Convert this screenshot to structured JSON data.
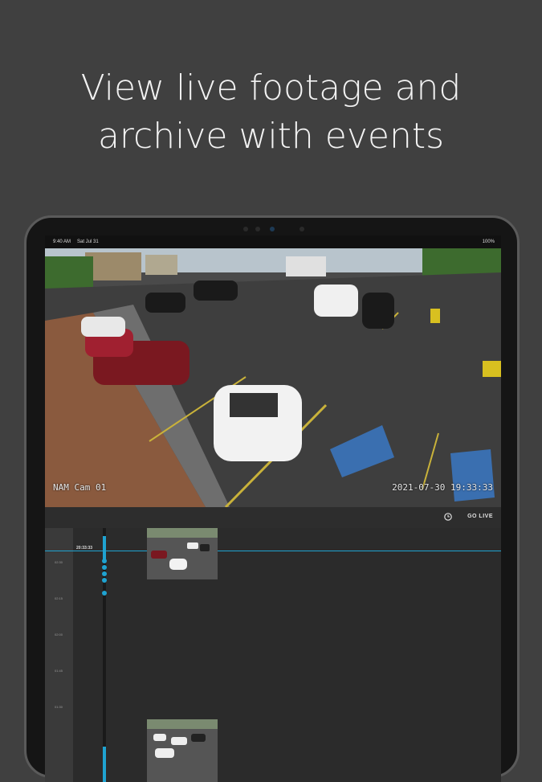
{
  "headline": {
    "line1": "View live footage and",
    "line2": "archive with events"
  },
  "status_bar": {
    "time": "9:40 AM",
    "date": "Sat Jul 31",
    "battery": "100%"
  },
  "camera": {
    "name": "NAM Cam 01",
    "timestamp": "2021-07-30 19:33:33"
  },
  "controls": {
    "go_live_label": "GO LIVE",
    "history_icon": "history-icon"
  },
  "timeline": {
    "current_time": "20:33:33",
    "ticks": [
      "02:30",
      "02:15",
      "02:00",
      "01:45",
      "01:30"
    ]
  },
  "colors": {
    "accent": "#1fa3d1",
    "background": "#404040"
  }
}
